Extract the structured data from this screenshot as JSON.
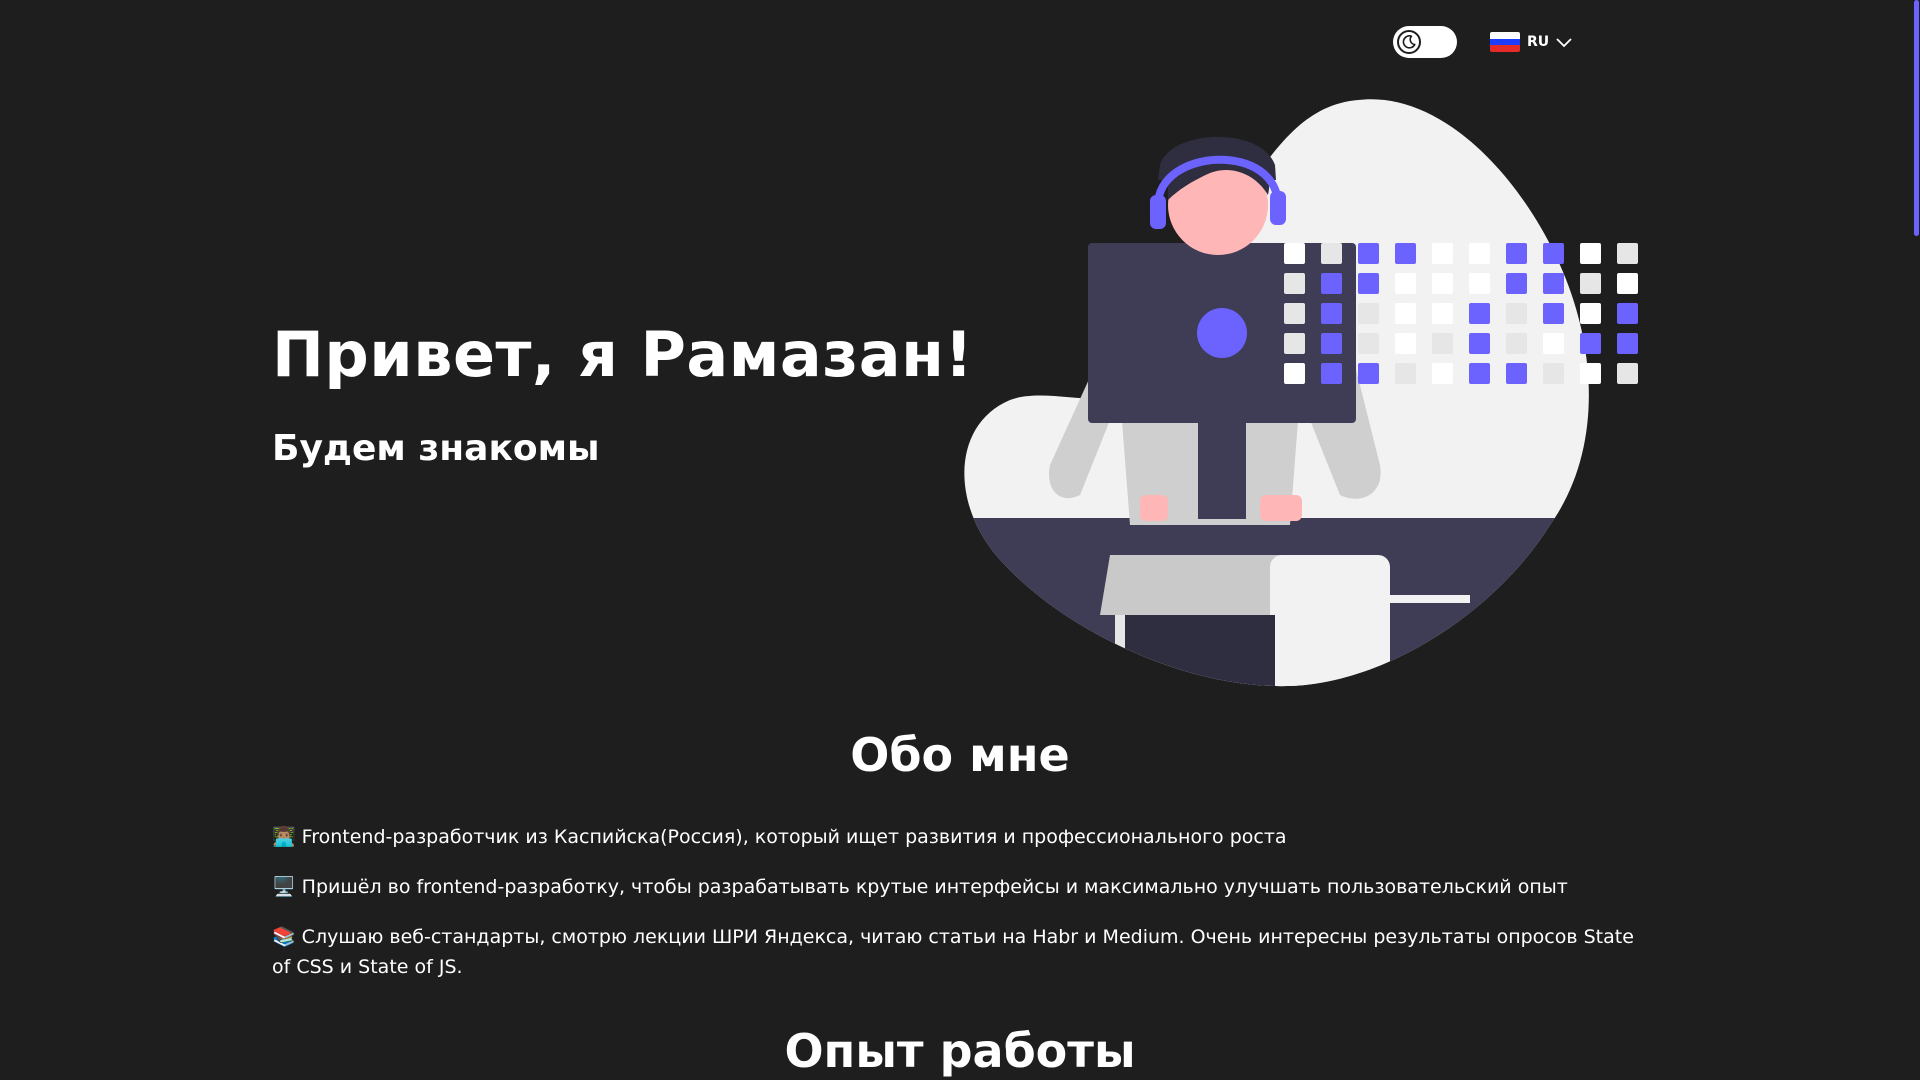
{
  "header": {
    "theme_toggle": {
      "icon": "moon-icon",
      "state": "dark"
    },
    "language": {
      "code": "RU",
      "flag": "russia-flag-icon",
      "flag_colors": [
        "#ffffff",
        "#1c3cff",
        "#e52a2a"
      ]
    }
  },
  "hero": {
    "title": "Привет, я Рамазан!",
    "subtitle": "Будем знакомы",
    "illustration": "developer-at-laptop-illustration"
  },
  "about": {
    "title": "Обо мне",
    "items": [
      {
        "emoji": "👨🏽‍💻",
        "text": "Frontend-разработчик из Каспийска(Россия), который ищет развития и профессионального роста"
      },
      {
        "emoji": "🖥️",
        "text": "Пришёл во frontend-разработку, чтобы разрабатывать крутые интерфейсы и максимально улучшать пользовательский опыт"
      },
      {
        "emoji": "📚",
        "text": "Слушаю веб-стандарты, смотрю лекции ШРИ Яндекса, читаю статьи на Habr и Medium. Очень интересны результаты опросов State of CSS и State of JS."
      }
    ]
  },
  "experience": {
    "title": "Опыт работы"
  },
  "colors": {
    "background": "#1f1e1f",
    "accent": "#6c63ff",
    "text": "#ffffff"
  }
}
